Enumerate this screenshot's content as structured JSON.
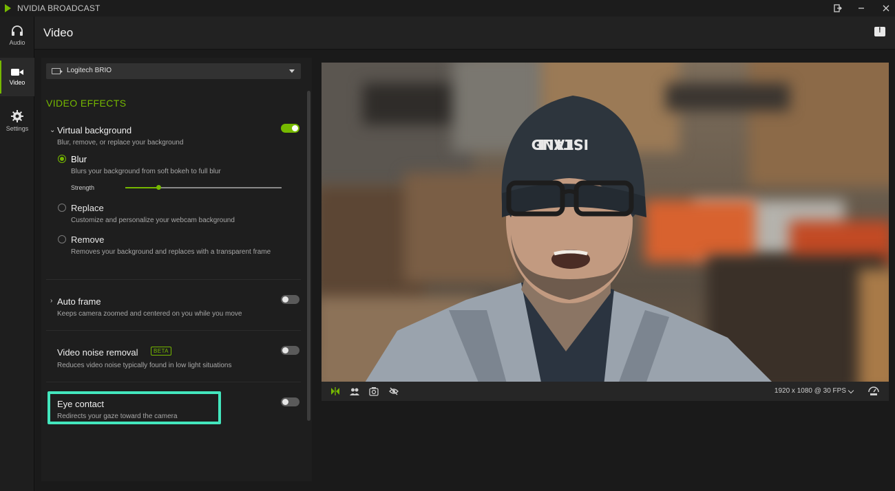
{
  "app": {
    "title": "NVIDIA BROADCAST"
  },
  "nav": {
    "items": [
      {
        "label": "Audio",
        "icon": "headphones-icon"
      },
      {
        "label": "Video",
        "icon": "camera-icon"
      },
      {
        "label": "Settings",
        "icon": "gear-icon"
      }
    ],
    "active": "Video"
  },
  "header": {
    "title": "Video"
  },
  "device": {
    "selected": "Logitech BRIO"
  },
  "effects": {
    "section_title": "VIDEO EFFECTS",
    "virtual_background": {
      "title": "Virtual background",
      "desc": "Blur, remove, or replace your background",
      "enabled": true,
      "options": [
        {
          "title": "Blur",
          "desc": "Blurs your background from soft bokeh to full blur",
          "selected": true
        },
        {
          "title": "Replace",
          "desc": "Customize and personalize your webcam background",
          "selected": false
        },
        {
          "title": "Remove",
          "desc": "Removes your background and replaces with a transparent frame",
          "selected": false
        }
      ],
      "strength_label": "Strength",
      "strength_value": 0.2
    },
    "auto_frame": {
      "title": "Auto frame",
      "desc": "Keeps camera zoomed and centered on you while you move",
      "enabled": false
    },
    "noise_removal": {
      "title": "Video noise removal",
      "badge": "BETA",
      "desc": "Reduces video noise typically found in low light situations",
      "enabled": false
    },
    "eye_contact": {
      "title": "Eye contact",
      "desc": "Redirects your gaze toward the camera",
      "enabled": false
    }
  },
  "preview": {
    "resolution": "1920 x 1080 @ 30 FPS",
    "toolbar_icons": [
      "mirror-icon",
      "people-icon",
      "snapshot-icon",
      "hide-preview-icon",
      "performance-icon"
    ]
  },
  "colors": {
    "accent": "#76b900",
    "highlight": "#43e6bd"
  }
}
